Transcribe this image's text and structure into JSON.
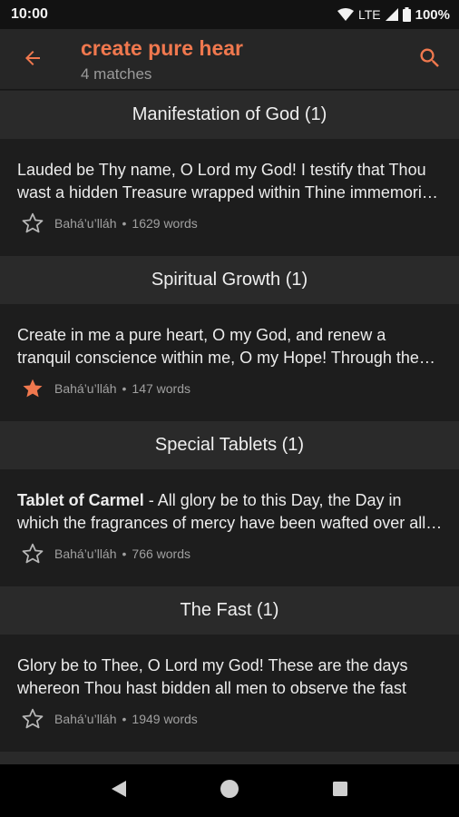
{
  "status_bar": {
    "time": "10:00",
    "network": "LTE",
    "battery": "100%"
  },
  "app_bar": {
    "query": "create pure hear",
    "matches": "4 matches",
    "accent_color": "#f0784e"
  },
  "sections": [
    {
      "header": "Manifestation of God (1)",
      "item": {
        "title": "",
        "text": "Lauded be Thy name, O Lord my God! I testify that Thou wast a hidden Treasure wrapped within Thine immemorial being and an impenetrable Mystery",
        "author": "Bahá’u’lláh",
        "words": "1629 words",
        "starred": false
      }
    },
    {
      "header": "Spiritual Growth (1)",
      "item": {
        "title": "",
        "text": "Create in me a pure heart, O my God, and renew a tranquil conscience within me, O my Hope! Through the spirit of power confirm Thou me in Thy Cause",
        "author": "Bahá’u’lláh",
        "words": "147 words",
        "starred": true
      }
    },
    {
      "header": "Special Tablets (1)",
      "item": {
        "title": "Tablet of Carmel",
        "text": " - All glory be to this Day, the Day in which the fragrances of mercy have been wafted over all created things",
        "author": "Bahá’u’lláh",
        "words": "766 words",
        "starred": false
      }
    },
    {
      "header": "The Fast (1)",
      "item": {
        "title": "",
        "text": "Glory be to Thee, O Lord my God! These are the days whereon Thou hast bidden all men to observe the fast",
        "author": "Bahá’u’lláh",
        "words": "1949 words",
        "starred": false
      }
    }
  ],
  "meta_separator": "•"
}
